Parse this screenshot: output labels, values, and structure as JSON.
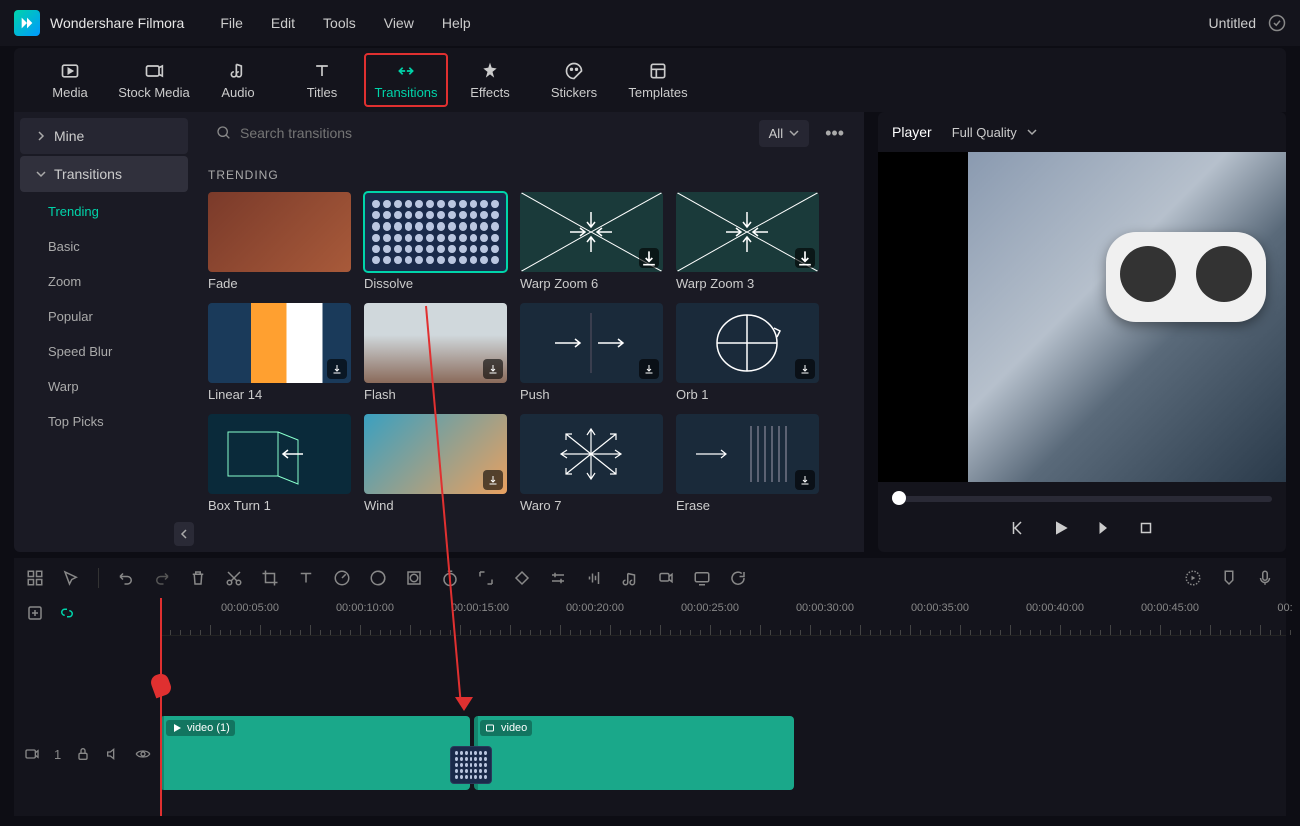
{
  "app": {
    "name": "Wondershare Filmora",
    "document": "Untitled"
  },
  "menubar": [
    "File",
    "Edit",
    "Tools",
    "View",
    "Help"
  ],
  "tabs": [
    {
      "id": "media",
      "label": "Media"
    },
    {
      "id": "stock",
      "label": "Stock Media"
    },
    {
      "id": "audio",
      "label": "Audio"
    },
    {
      "id": "titles",
      "label": "Titles"
    },
    {
      "id": "transitions",
      "label": "Transitions"
    },
    {
      "id": "effects",
      "label": "Effects"
    },
    {
      "id": "stickers",
      "label": "Stickers"
    },
    {
      "id": "templates",
      "label": "Templates"
    }
  ],
  "sidebar": {
    "mine": "Mine",
    "category": "Transitions",
    "items": [
      "Trending",
      "Basic",
      "Zoom",
      "Popular",
      "Speed Blur",
      "Warp",
      "Top Picks"
    ]
  },
  "search": {
    "placeholder": "Search transitions",
    "filter_label": "All"
  },
  "section_title": "TRENDING",
  "transitions": [
    {
      "name": "Fade",
      "thumb": "fade",
      "dl": false,
      "selected": false
    },
    {
      "name": "Dissolve",
      "thumb": "dissolve",
      "dl": false,
      "selected": true
    },
    {
      "name": "Warp Zoom 6",
      "thumb": "warp",
      "dl": true,
      "selected": false
    },
    {
      "name": "Warp Zoom 3",
      "thumb": "warp",
      "dl": true,
      "selected": false
    },
    {
      "name": "Linear 14",
      "thumb": "linear",
      "dl": true,
      "selected": false
    },
    {
      "name": "Flash",
      "thumb": "flash",
      "dl": true,
      "selected": false
    },
    {
      "name": "Push",
      "thumb": "push",
      "dl": true,
      "selected": false
    },
    {
      "name": "Orb 1",
      "thumb": "orb",
      "dl": true,
      "selected": false
    },
    {
      "name": "Box Turn 1",
      "thumb": "boxturn",
      "dl": false,
      "selected": false
    },
    {
      "name": "Wind",
      "thumb": "wind",
      "dl": true,
      "selected": false
    },
    {
      "name": "Waro 7",
      "thumb": "waro7",
      "dl": false,
      "selected": false
    },
    {
      "name": "Erase",
      "thumb": "erase",
      "dl": true,
      "selected": false
    }
  ],
  "preview": {
    "player_label": "Player",
    "quality": "Full Quality"
  },
  "ruler_marks": [
    "00:00:05:00",
    "00:00:10:00",
    "00:00:15:00",
    "00:00:20:00",
    "00:00:25:00",
    "00:00:30:00",
    "00:00:35:00",
    "00:00:40:00",
    "00:00:45:00",
    "00:"
  ],
  "clips": [
    {
      "label": "video (1)"
    },
    {
      "label": "video"
    }
  ],
  "track_head_index": "1"
}
